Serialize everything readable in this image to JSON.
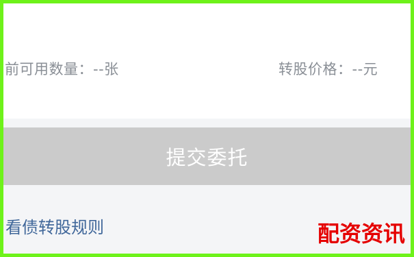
{
  "info": {
    "left_text": "前可用数量：--张",
    "right_text": "转股价格：--元"
  },
  "actions": {
    "submit_label": "提交委托",
    "rule_link_label": "看债转股规则"
  },
  "watermark": {
    "text": "配资资讯"
  },
  "colors": {
    "border": "#6ef21a",
    "button_disabled": "#cbcbcb",
    "link": "#40679a",
    "watermark": "#e50000"
  }
}
